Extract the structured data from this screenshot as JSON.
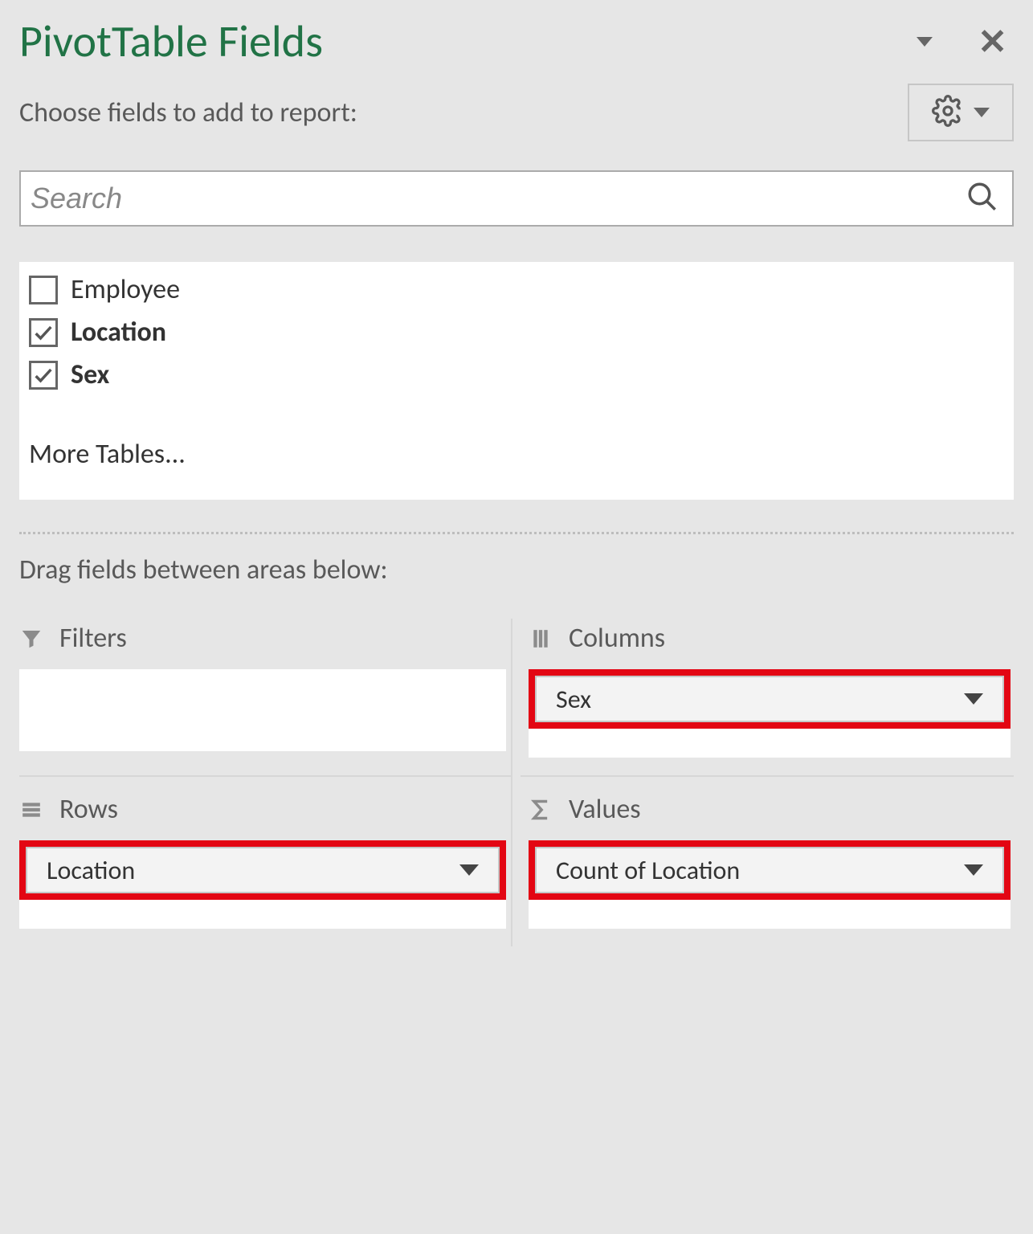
{
  "header": {
    "title": "PivotTable Fields"
  },
  "subheader": {
    "text": "Choose fields to add to report:"
  },
  "search": {
    "placeholder": "Search"
  },
  "fields": [
    {
      "label": "Employee",
      "checked": false
    },
    {
      "label": "Location",
      "checked": true
    },
    {
      "label": "Sex",
      "checked": true
    }
  ],
  "more_tables": "More Tables...",
  "drag_text": "Drag fields between areas below:",
  "areas": {
    "filters": {
      "label": "Filters"
    },
    "columns": {
      "label": "Columns",
      "item": "Sex"
    },
    "rows": {
      "label": "Rows",
      "item": "Location"
    },
    "values": {
      "label": "Values",
      "item": "Count of Location"
    }
  }
}
